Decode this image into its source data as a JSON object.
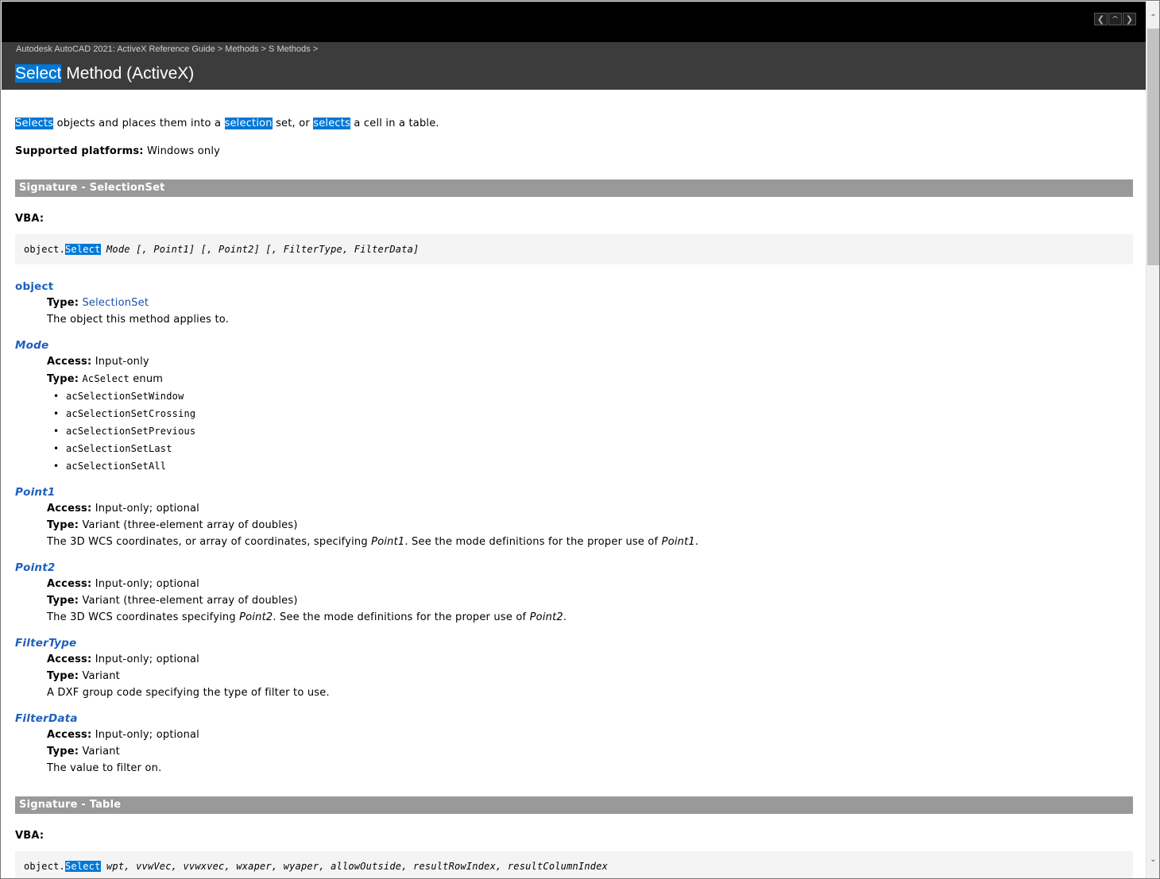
{
  "nav": {
    "prev_icon": "chevron-left-icon",
    "up_icon": "chevron-up-icon",
    "next_icon": "chevron-right-icon"
  },
  "breadcrumb": [
    "Autodesk AutoCAD 2021: ActiveX Reference Guide",
    "Methods",
    "S Methods"
  ],
  "breadcrumb_sep": ">",
  "title": {
    "highlight": "Select",
    "rest": " Method (ActiveX)"
  },
  "intro": {
    "w1": "Selects",
    "t1": " objects and places them into a ",
    "w2": "selection",
    "t2": " set, or ",
    "w3": "selects",
    "t3": " a cell in a table."
  },
  "platforms": {
    "label": "Supported platforms:",
    "value": " Windows only"
  },
  "sig1": {
    "title": "Signature - SelectionSet",
    "vba_label": "VBA:",
    "code_prefix": "object.",
    "code_highlight": "Select",
    "code_args": " Mode [, Point1] [, Point2] [, FilterType, FilterData]"
  },
  "params": {
    "object": {
      "name": "object",
      "type_label": "Type:",
      "type_value": "SelectionSet",
      "desc": "The object this method applies to."
    },
    "mode": {
      "name": "Mode",
      "access_label": "Access:",
      "access_value": " Input-only",
      "type_label": "Type:",
      "type_code": "AcSelect",
      "type_rest": " enum",
      "options": [
        "acSelectionSetWindow",
        "acSelectionSetCrossing",
        "acSelectionSetPrevious",
        "acSelectionSetLast",
        "acSelectionSetAll"
      ]
    },
    "point1": {
      "name": "Point1",
      "access_label": "Access:",
      "access_value": " Input-only; optional",
      "type_label": "Type:",
      "type_value": " Variant (three-element array of doubles)",
      "desc_a": "The 3D WCS coordinates, or array of coordinates, specifying ",
      "desc_i1": "Point1",
      "desc_b": ". See the mode definitions for the proper use of ",
      "desc_i2": "Point1",
      "desc_c": "."
    },
    "point2": {
      "name": "Point2",
      "access_label": "Access:",
      "access_value": " Input-only; optional",
      "type_label": "Type:",
      "type_value": " Variant (three-element array of doubles)",
      "desc_a": "The 3D WCS coordinates specifying ",
      "desc_i1": "Point2",
      "desc_b": ". See the mode definitions for the proper use of ",
      "desc_i2": "Point2",
      "desc_c": "."
    },
    "filtertype": {
      "name": "FilterType",
      "access_label": "Access:",
      "access_value": " Input-only; optional",
      "type_label": "Type:",
      "type_value": " Variant",
      "desc": "A DXF group code specifying the type of filter to use."
    },
    "filterdata": {
      "name": "FilterData",
      "access_label": "Access:",
      "access_value": " Input-only; optional",
      "type_label": "Type:",
      "type_value": " Variant",
      "desc": "The value to filter on."
    }
  },
  "sig2": {
    "title": "Signature - Table",
    "vba_label": "VBA:",
    "code_prefix": "object.",
    "code_highlight": "Select",
    "code_args": " wpt, vvwVec, vvwxvec, wxaper, wyaper, allowOutside, resultRowIndex, resultColumnIndex"
  }
}
